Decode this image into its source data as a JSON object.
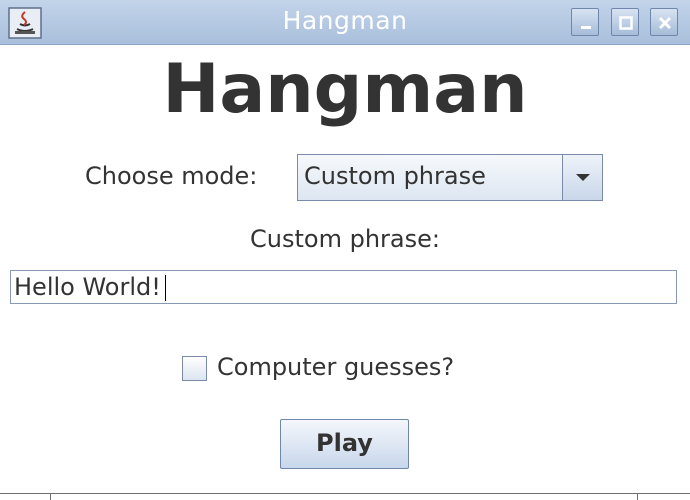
{
  "window": {
    "title": "Hangman",
    "icon": "java-icon"
  },
  "main": {
    "heading": "Hangman",
    "mode_label": "Choose mode:",
    "mode_selected": "Custom phrase",
    "phrase_label": "Custom phrase:",
    "phrase_value": "Hello World!",
    "checkbox_label": "Computer guesses?",
    "checkbox_checked": false,
    "play_label": "Play"
  },
  "colors": {
    "titlebar": "#b4c8e2",
    "text": "#333333",
    "border": "#7a8aa8"
  }
}
